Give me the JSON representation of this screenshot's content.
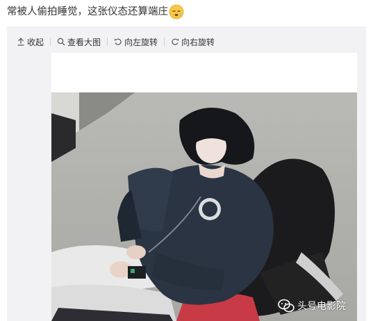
{
  "post": {
    "text": "常被人偷拍睡觉，这张仪态还算端庄",
    "emoji": "sleepy-face-emoji"
  },
  "toolbar": {
    "collapse_label": "收起",
    "view_large_label": "查看大图",
    "rotate_left_label": "向左旋转",
    "rotate_right_label": "向右旋转"
  },
  "photo": {
    "description_icon": "sleeping-person-photo",
    "watermark_text": "头号电影院"
  },
  "colors": {
    "panel_bg": "#f2f2f5",
    "text": "#333333"
  }
}
